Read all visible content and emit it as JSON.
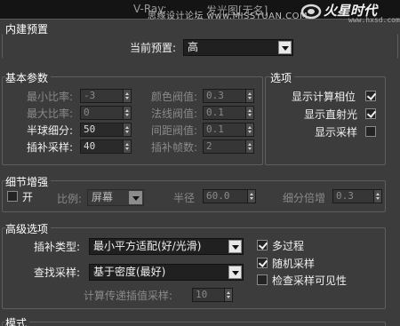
{
  "window": {
    "title_left": "V-Ray:",
    "title_right": "发光图[无名]",
    "watermark": "思缘设计论坛 www.MISSYUAN.COM",
    "logo_text": "火星时代",
    "logo_url": "www.hxsd.com"
  },
  "builtin_presets": {
    "section_title": "内建预置",
    "current_preset_label": "当前预置:",
    "current_preset_value": "高"
  },
  "basic_params": {
    "section_title": "基本参数",
    "min_rate_label": "最小比率:",
    "min_rate_value": "-3",
    "max_rate_label": "最大比率:",
    "max_rate_value": "0",
    "hsph_subdivs_label": "半球细分:",
    "hsph_subdivs_value": "50",
    "interp_samples_label": "插补采样:",
    "interp_samples_value": "40",
    "color_thresh_label": "颜色阀值:",
    "color_thresh_value": "0.3",
    "normal_thresh_label": "法线阀值:",
    "normal_thresh_value": "0.1",
    "dist_thresh_label": "间距阀值:",
    "dist_thresh_value": "0.1",
    "interp_frames_label": "插补帧数:",
    "interp_frames_value": "2"
  },
  "options": {
    "section_title": "选项",
    "show_calc_phase_label": "显示计算相位",
    "show_calc_phase_checked": true,
    "show_direct_light_label": "显示直射光",
    "show_direct_light_checked": true,
    "show_samples_label": "显示采样",
    "show_samples_checked": false
  },
  "detail": {
    "section_title": "细节增强",
    "on_label": "开",
    "on_checked": false,
    "scale_label": "比例:",
    "scale_value": "屏幕",
    "radius_label": "半径",
    "radius_value": "60.0",
    "subdivs_mult_label": "细分倍增",
    "subdivs_mult_value": "0.3"
  },
  "advanced": {
    "section_title": "高级选项",
    "interp_type_label": "插补类型:",
    "interp_type_value": "最小平方适配(好/光滑)",
    "lookup_label": "查找采样:",
    "lookup_value": "基于密度(最好)",
    "calc_pass_label": "计算传递插值采样:",
    "calc_pass_value": "10",
    "multipass_label": "多过程",
    "multipass_checked": true,
    "randomize_label": "随机采样",
    "randomize_checked": true,
    "check_visibility_label": "检查采样可见性",
    "check_visibility_checked": false
  },
  "mode": {
    "section_title": "模式"
  }
}
